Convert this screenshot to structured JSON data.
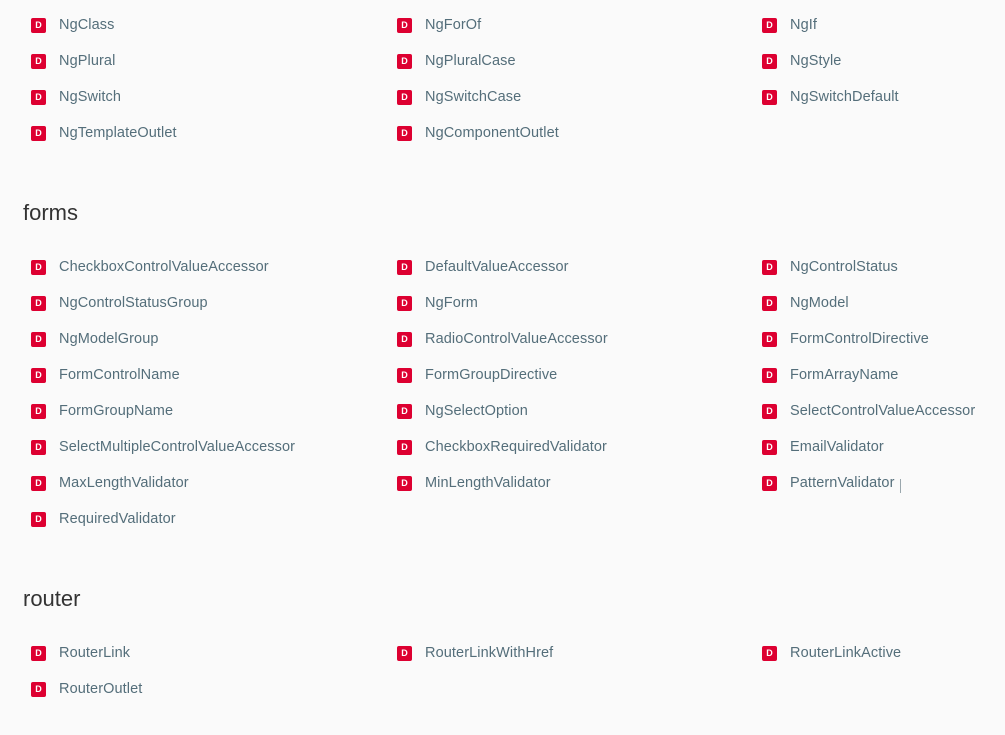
{
  "icons": {
    "directive_badge": "directive-badge-icon",
    "directive_badge_letter": "D",
    "badge_color": "#dd0031",
    "text_color": "#546e7a"
  },
  "sections": [
    {
      "title": "",
      "items": [
        "NgClass",
        "NgForOf",
        "NgIf",
        "NgPlural",
        "NgPluralCase",
        "NgStyle",
        "NgSwitch",
        "NgSwitchCase",
        "NgSwitchDefault",
        "NgTemplateOutlet",
        "NgComponentOutlet"
      ]
    },
    {
      "title": "forms",
      "items": [
        "CheckboxControlValueAccessor",
        "DefaultValueAccessor",
        "NgControlStatus",
        "NgControlStatusGroup",
        "NgForm",
        "NgModel",
        "NgModelGroup",
        "RadioControlValueAccessor",
        "FormControlDirective",
        "FormControlName",
        "FormGroupDirective",
        "FormArrayName",
        "FormGroupName",
        "NgSelectOption",
        "SelectControlValueAccessor",
        "SelectMultipleControlValueAccessor",
        "CheckboxRequiredValidator",
        "EmailValidator",
        "MaxLengthValidator",
        "MinLengthValidator",
        "PatternValidator",
        "RequiredValidator"
      ]
    },
    {
      "title": "router",
      "items": [
        "RouterLink",
        "RouterLinkWithHref",
        "RouterLinkActive",
        "RouterOutlet"
      ]
    }
  ]
}
